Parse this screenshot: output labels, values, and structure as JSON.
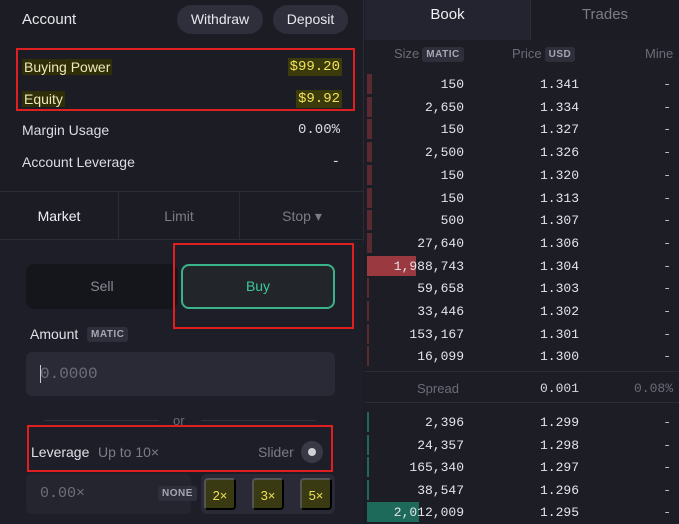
{
  "account": {
    "title": "Account",
    "withdraw_label": "Withdraw",
    "deposit_label": "Deposit",
    "buying_power_label": "Buying Power",
    "buying_power_value": "$99.20",
    "equity_label": "Equity",
    "equity_value": "$9.92",
    "margin_usage_label": "Margin Usage",
    "margin_usage_value": "0.00%",
    "leverage_label": "Account Leverage",
    "leverage_value": "-"
  },
  "order_tabs": {
    "market": "Market",
    "limit": "Limit",
    "stop": "Stop ▾"
  },
  "order": {
    "sell_label": "Sell",
    "buy_label": "Buy",
    "amount_label": "Amount",
    "amount_unit": "MATIC",
    "amount_placeholder": "0.0000",
    "or_label": "or",
    "leverage_label": "Leverage",
    "leverage_sub": "Up to 10×",
    "slider_label": "Slider",
    "leverage_input_value": "0.00×",
    "none_label": "NONE",
    "preset_2x": "2×",
    "preset_3x": "3×",
    "preset_5x": "5×"
  },
  "book": {
    "tab_book": "Book",
    "tab_trades": "Trades",
    "col_size": "Size",
    "col_size_unit": "MATIC",
    "col_price": "Price",
    "col_price_unit": "USD",
    "col_mine": "Mine",
    "asks": [
      {
        "size": "150",
        "price": "1.341",
        "mine": "-",
        "depth": 0.1
      },
      {
        "size": "2,650",
        "price": "1.334",
        "mine": "-",
        "depth": 0.1
      },
      {
        "size": "150",
        "price": "1.327",
        "mine": "-",
        "depth": 0.1
      },
      {
        "size": "2,500",
        "price": "1.326",
        "mine": "-",
        "depth": 0.1
      },
      {
        "size": "150",
        "price": "1.320",
        "mine": "-",
        "depth": 0.1
      },
      {
        "size": "150",
        "price": "1.313",
        "mine": "-",
        "depth": 0.1
      },
      {
        "size": "500",
        "price": "1.307",
        "mine": "-",
        "depth": 0.1
      },
      {
        "size": "27,640",
        "price": "1.306",
        "mine": "-",
        "depth": 0.1
      },
      {
        "size": "1,988,743",
        "price": "1.304",
        "mine": "-",
        "depth": 0.946
      },
      {
        "size": "59,658",
        "price": "1.303",
        "mine": "-",
        "depth": 0.02
      },
      {
        "size": "33,446",
        "price": "1.302",
        "mine": "-",
        "depth": 0.012
      },
      {
        "size": "153,167",
        "price": "1.301",
        "mine": "-",
        "depth": 0.012
      },
      {
        "size": "16,099",
        "price": "1.300",
        "mine": "-",
        "depth": 0.006
      }
    ],
    "spread_label": "Spread",
    "spread_value": "0.001",
    "spread_pct": "0.08%",
    "bids": [
      {
        "size": "2,396",
        "price": "1.299",
        "mine": "-",
        "depth": 0.002
      },
      {
        "size": "24,357",
        "price": "1.298",
        "mine": "-",
        "depth": 0.007
      },
      {
        "size": "165,340",
        "price": "1.297",
        "mine": "-",
        "depth": 0.033
      },
      {
        "size": "38,547",
        "price": "1.296",
        "mine": "-",
        "depth": 0.012
      },
      {
        "size": "2,012,009",
        "price": "1.295",
        "mine": "-",
        "depth": 1.0
      }
    ]
  },
  "colors": {
    "ask_bar": "#5a2a30",
    "ask_bar_big": "#9a3a40",
    "bid_bar": "#1e6a5a",
    "buy_accent": "#3bb38a",
    "highlight": "#f2e25c",
    "annotation_red": "#e02020"
  }
}
